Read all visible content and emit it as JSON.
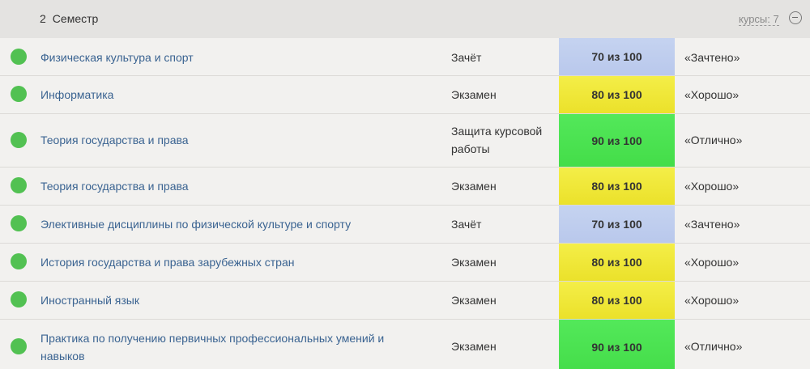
{
  "semester": {
    "number": "2",
    "title": "Семестр",
    "courses_count": "курсы: 7"
  },
  "colors": {
    "status_ok": "#52c152",
    "link": "#3a6391",
    "score_pass": "#c5d3f0",
    "score_good": "#f4ee48",
    "score_excellent": "#53e85a"
  },
  "courses": [
    {
      "name": "Физическая культура и спорт",
      "control": "Зачёт",
      "score": "70 из 100",
      "score_level": 0.7,
      "grade": "«Зачтено»"
    },
    {
      "name": "Информатика",
      "control": "Экзамен",
      "score": "80 из 100",
      "score_level": 0.8,
      "grade": "«Хорошо»"
    },
    {
      "name": "Теория государства и права",
      "control": "Защита курсовой работы",
      "score": "90 из 100",
      "score_level": 0.9,
      "grade": "«Отлично»"
    },
    {
      "name": "Теория государства и права",
      "control": "Экзамен",
      "score": "80 из 100",
      "score_level": 0.8,
      "grade": "«Хорошо»"
    },
    {
      "name": "Элективные дисциплины по физической культуре и спорту",
      "control": "Зачёт",
      "score": "70 из 100",
      "score_level": 0.7,
      "grade": "«Зачтено»"
    },
    {
      "name": "История государства и права зарубежных стран",
      "control": "Экзамен",
      "score": "80 из 100",
      "score_level": 0.8,
      "grade": "«Хорошо»"
    },
    {
      "name": "Иностранный язык",
      "control": "Экзамен",
      "score": "80 из 100",
      "score_level": 0.8,
      "grade": "«Хорошо»"
    },
    {
      "name": "Практика по получению первичных профессиональных умений и навыков",
      "control": "Экзамен",
      "score": "90 из 100",
      "score_level": 0.9,
      "grade": "«Отлично»"
    }
  ]
}
